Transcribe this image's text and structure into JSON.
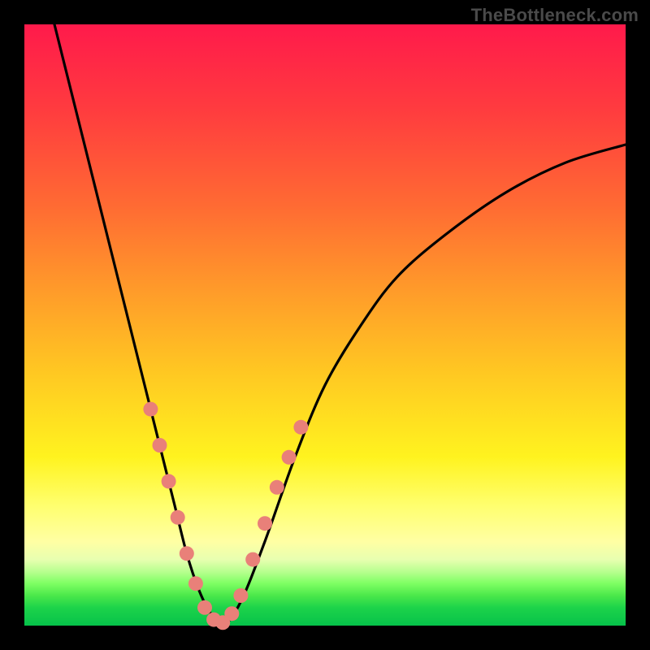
{
  "watermark": "TheBottleneck.com",
  "chart_data": {
    "type": "line",
    "title": "",
    "xlabel": "",
    "ylabel": "",
    "xlim": [
      0,
      100
    ],
    "ylim": [
      0,
      100
    ],
    "grid": false,
    "legend": false,
    "series": [
      {
        "name": "curve",
        "color": "#000000",
        "x": [
          5,
          8,
          12,
          16,
          20,
          23,
          25,
          27,
          29,
          31,
          33,
          36,
          40,
          45,
          50,
          56,
          62,
          70,
          80,
          90,
          100
        ],
        "y": [
          100,
          88,
          72,
          56,
          40,
          28,
          20,
          12,
          6,
          2,
          0,
          4,
          14,
          28,
          40,
          50,
          58,
          65,
          72,
          77,
          80
        ]
      }
    ],
    "markers": {
      "name": "dots",
      "color": "#e98079",
      "radius": 9,
      "points": [
        {
          "x": 21,
          "y": 36
        },
        {
          "x": 22.5,
          "y": 30
        },
        {
          "x": 24,
          "y": 24
        },
        {
          "x": 25.5,
          "y": 18
        },
        {
          "x": 27,
          "y": 12
        },
        {
          "x": 28.5,
          "y": 7
        },
        {
          "x": 30,
          "y": 3
        },
        {
          "x": 31.5,
          "y": 1
        },
        {
          "x": 33,
          "y": 0.5
        },
        {
          "x": 34.5,
          "y": 2
        },
        {
          "x": 36,
          "y": 5
        },
        {
          "x": 38,
          "y": 11
        },
        {
          "x": 40,
          "y": 17
        },
        {
          "x": 42,
          "y": 23
        },
        {
          "x": 44,
          "y": 28
        },
        {
          "x": 46,
          "y": 33
        }
      ]
    }
  }
}
